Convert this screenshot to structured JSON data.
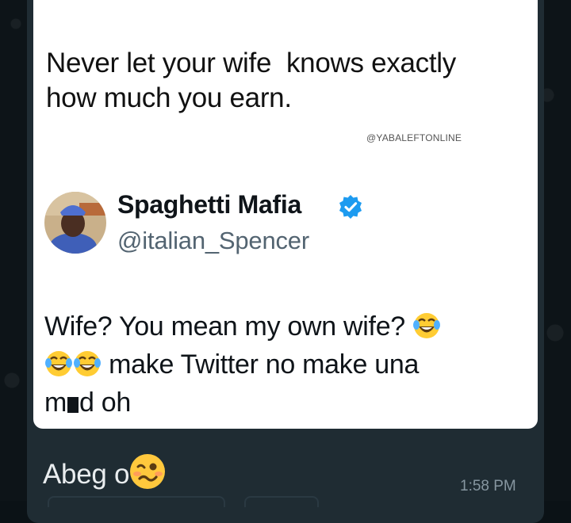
{
  "shared_screenshot": {
    "quoted_text": "Never let your wife  knows exactly\nhow much you earn.",
    "watermark": "@YABALEFTONLINE",
    "tweet": {
      "display_name": "Spaghetti Mafia",
      "handle": "@italian_Spencer",
      "text_part1": "Wife? You mean my own wife? ",
      "text_part2": " make Twitter no make una",
      "text_part3": "m",
      "text_part4": "d oh"
    }
  },
  "message": {
    "caption": "Abeg o",
    "time": "1:58 PM"
  },
  "colors": {
    "chat_background": "#0d1418",
    "bubble": "#1f2c33",
    "verified": "#1d9bf0",
    "caption_text": "#e9edef",
    "timestamp": "#8696a0"
  },
  "icons": [
    "verified-badge-icon",
    "face-with-tears-of-joy-emoji",
    "woozy-face-emoji"
  ]
}
